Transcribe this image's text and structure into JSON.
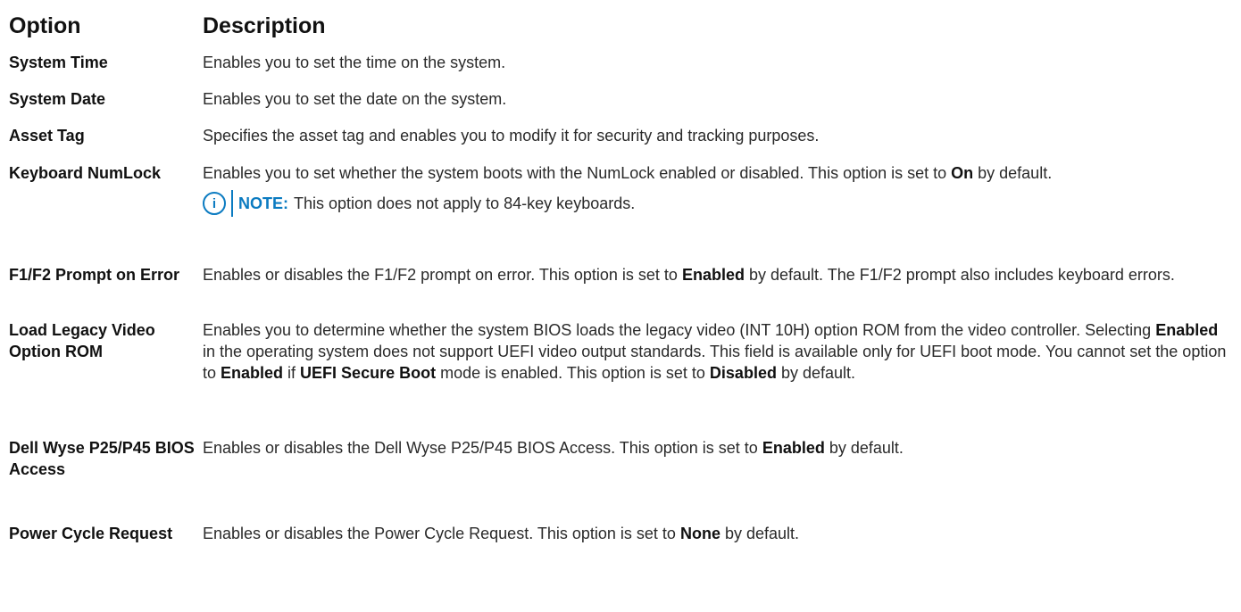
{
  "header": {
    "option": "Option",
    "description": "Description"
  },
  "rows": [
    {
      "option": "System Time",
      "desc": [
        "Enables you to set the time on the system."
      ]
    },
    {
      "option": "System Date",
      "desc": [
        "Enables you to set the date on the system."
      ]
    },
    {
      "option": "Asset Tag",
      "desc": [
        "Specifies the asset tag and enables you to modify it for security and tracking purposes."
      ]
    },
    {
      "option": "Keyboard NumLock",
      "desc": [
        "Enables you to set whether the system boots with the NumLock enabled or disabled. This option is set to ",
        "On",
        " by default."
      ],
      "note_label": "NOTE:",
      "note_text": "This option does not apply to 84-key keyboards."
    },
    {
      "option": "F1/F2 Prompt on Error",
      "desc": [
        "Enables or disables the F1/F2 prompt on error. This option is set to ",
        "Enabled",
        " by default. The F1/F2 prompt also includes keyboard errors."
      ]
    },
    {
      "option": "Load Legacy Video Option ROM",
      "desc": [
        "Enables you to determine whether the system BIOS loads the legacy video (INT 10H) option ROM from the video controller. Selecting ",
        "Enabled",
        " in the operating system does not support UEFI video output standards. This field is available only for UEFI boot mode. You cannot set the option to ",
        "Enabled",
        " if ",
        "UEFI Secure Boot",
        " mode is enabled. This option is set to ",
        "Disabled",
        " by default."
      ]
    },
    {
      "option": "Dell Wyse P25/P45 BIOS Access",
      "desc": [
        "Enables or disables the Dell Wyse P25/P45 BIOS Access. This option is set to ",
        "Enabled",
        " by default."
      ]
    },
    {
      "option": "Power Cycle Request",
      "desc": [
        "Enables or disables the Power Cycle Request. This option is set to ",
        "None",
        " by default."
      ]
    }
  ],
  "icons": {
    "note": "info-icon"
  },
  "colors": {
    "note_accent": "#0b7bc1"
  }
}
